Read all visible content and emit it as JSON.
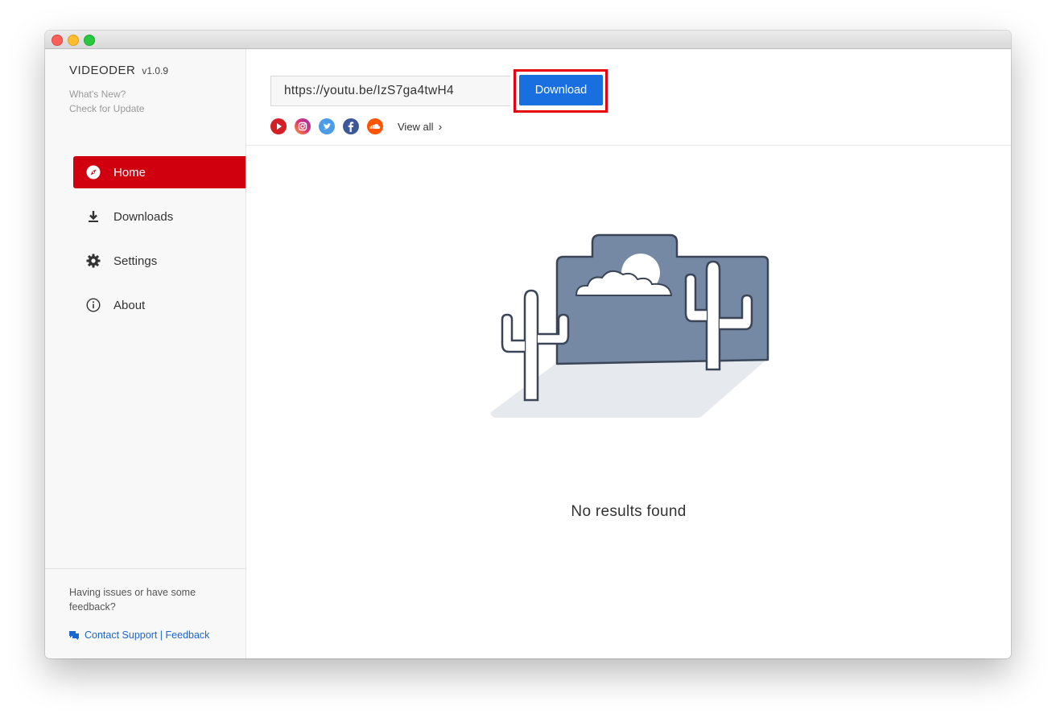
{
  "app": {
    "name": "VIDEODER",
    "version": "v1.0.9"
  },
  "sidebar": {
    "whats_new": "What's New?",
    "check_update": "Check for Update",
    "nav": [
      {
        "label": "Home",
        "icon": "compass-icon",
        "active": true
      },
      {
        "label": "Downloads",
        "icon": "download-icon",
        "active": false
      },
      {
        "label": "Settings",
        "icon": "gear-icon",
        "active": false
      },
      {
        "label": "About",
        "icon": "info-icon",
        "active": false
      }
    ],
    "footer": {
      "issue_text": "Having issues or have some feedback?",
      "support_link": "Contact Support | Feedback"
    }
  },
  "main": {
    "url_value": "https://youtu.be/IzS7ga4twH4",
    "download_label": "Download",
    "sources": [
      "youtube-icon",
      "instagram-icon",
      "twitter-icon",
      "facebook-icon",
      "soundcloud-icon"
    ],
    "view_all": "View all",
    "empty_message": "No results found"
  },
  "colors": {
    "accent_red": "#d1000f",
    "button_blue": "#1a6fe0",
    "link_blue": "#1a66d2",
    "highlight_red": "#e8000e"
  }
}
